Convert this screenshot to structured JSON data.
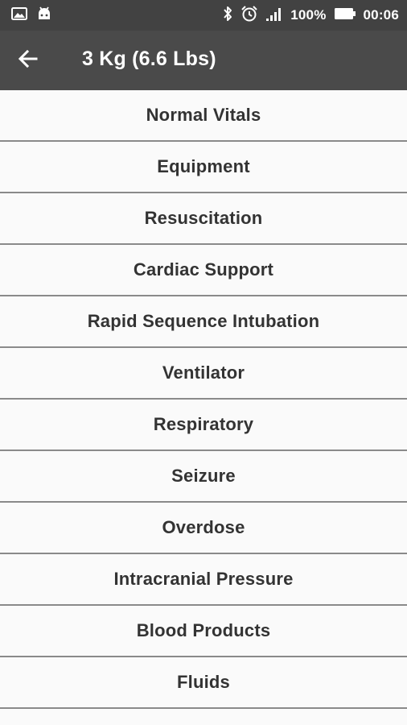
{
  "status_bar": {
    "battery_text": "100%",
    "time": "00:06",
    "icons": [
      "image-notification-icon",
      "android-notification-icon",
      "bluetooth-icon",
      "alarm-icon",
      "signal-icon",
      "battery-icon"
    ]
  },
  "app_bar": {
    "back_icon": "arrow-back-icon",
    "title": "3 Kg (6.6 Lbs)"
  },
  "menu": {
    "items": [
      {
        "label": "Normal Vitals"
      },
      {
        "label": "Equipment"
      },
      {
        "label": "Resuscitation"
      },
      {
        "label": "Cardiac Support"
      },
      {
        "label": "Rapid Sequence Intubation"
      },
      {
        "label": "Ventilator"
      },
      {
        "label": "Respiratory"
      },
      {
        "label": "Seizure"
      },
      {
        "label": "Overdose"
      },
      {
        "label": "Intracranial Pressure"
      },
      {
        "label": "Blood Products"
      },
      {
        "label": "Fluids"
      }
    ]
  },
  "colors": {
    "status_bar": "#424242",
    "app_bar": "#4a4a4a",
    "list_background": "#fafafa",
    "divider": "#8a8a8a",
    "text": "#333333"
  }
}
